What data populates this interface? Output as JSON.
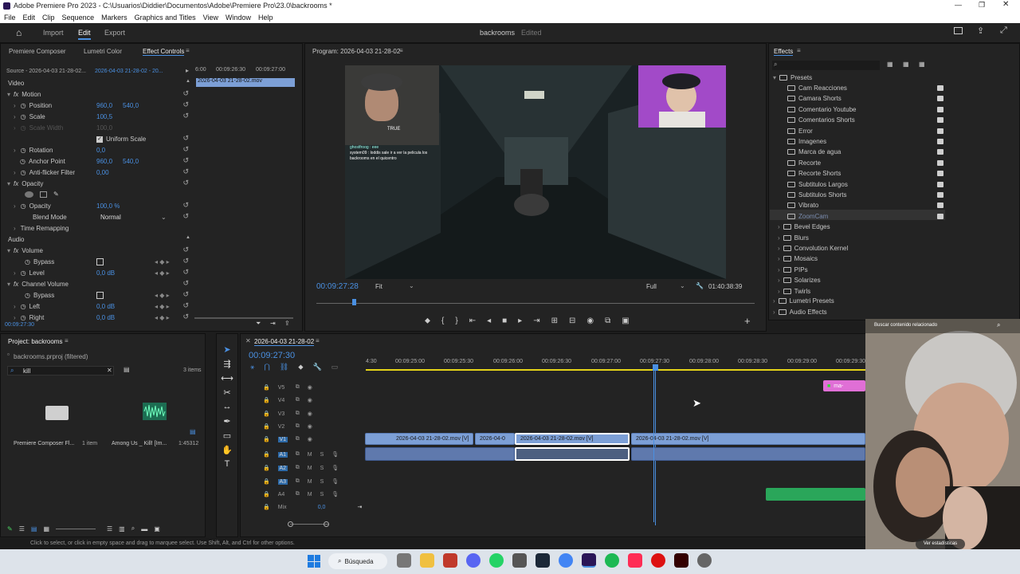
{
  "titlebar": {
    "title": "Adobe Premiere Pro 2023 - C:\\Usuarios\\Diddier\\Documentos\\Adobe\\Premiere Pro\\23.0\\backrooms *"
  },
  "menu": [
    "File",
    "Edit",
    "Clip",
    "Sequence",
    "Markers",
    "Graphics and Titles",
    "View",
    "Window",
    "Help"
  ],
  "workspace": {
    "tabs": [
      "Import",
      "Edit",
      "Export"
    ],
    "project_name": "backrooms",
    "status": "Edited"
  },
  "effect_controls": {
    "tabs": [
      "Premiere Composer",
      "Lumetri Color",
      "Effect Controls"
    ],
    "source": "Source - 2026-04-03 21-28-02...",
    "clip": "2026-04-03 21-28-02 - 20...",
    "ruler": [
      "6:00",
      "00:09:26:30",
      "00:09:27:00"
    ],
    "clip_bar": "2026-04-03 21-28-02.mov",
    "video_label": "Video",
    "audio_label": "Audio",
    "motion": "Motion",
    "position_label": "Position",
    "position_x": "960,0",
    "position_y": "540,0",
    "scale_label": "Scale",
    "scale_value": "100,5",
    "scale_width_label": "Scale Width",
    "scale_width_value": "100,0",
    "uniform_label": "Uniform Scale",
    "rotation_label": "Rotation",
    "rotation_value": "0,0",
    "anchor_label": "Anchor Point",
    "anchor_x": "960,0",
    "anchor_y": "540,0",
    "antiflicker_label": "Anti-flicker Filter",
    "antiflicker_value": "0,00",
    "opacity": "Opacity",
    "opacity_label": "Opacity",
    "opacity_value": "100,0 %",
    "blend_label": "Blend Mode",
    "blend_value": "Normal",
    "time_remap": "Time Remapping",
    "volume": "Volume",
    "bypass_label": "Bypass",
    "level_label": "Level",
    "level_value": "0,0 dB",
    "channel_volume": "Channel Volume",
    "left_label": "Left",
    "left_value": "0,0 dB",
    "right_label": "Right",
    "right_value": "0,0 dB",
    "timecode": "00:09:27:30"
  },
  "program": {
    "title": "Program: 2026-04-03 21-28-02",
    "timecode": "00:09:27:28",
    "fit": "Fit",
    "quality": "Full",
    "duration": "01:40:38:39",
    "chat_user1": "ghostfroog : eee",
    "chat_user2": "system09 : loddis sale ir a ver la pelicula los backrooms en el quicentro",
    "cam_caption": "TRUE"
  },
  "effects": {
    "title": "Effects",
    "presets_label": "Presets",
    "presets": [
      "Cam Reacciones",
      "Camara Shorts",
      "Comentario Youtube",
      "Comentarios Shorts",
      "Error",
      "Imagenes",
      "Marca de agua",
      "Recorte",
      "Recorte Shorts",
      "Subtitulos Largos",
      "Subtitulos Shorts",
      "Vibrato",
      "ZoomCam"
    ],
    "categories": [
      "Bevel Edges",
      "Blurs",
      "Convolution Kernel",
      "Mosaics",
      "PIPs",
      "Solarizes",
      "Twirls"
    ],
    "lumetri": "Lumetri Presets",
    "audio_effects": "Audio Effects"
  },
  "project": {
    "title": "Project: backrooms",
    "file": "backrooms.prproj (filtered)",
    "search": "kill",
    "items_count": "3 items",
    "item1_label": "Premiere Composer Fl...",
    "item1_meta": "1 item",
    "item2_label": "Among Us _ Kill! [Im...",
    "item2_meta": "1:45312"
  },
  "timeline": {
    "title": "2026-04-03 21-28-02",
    "timecode": "00:09:27:30",
    "ruler": [
      "4:30",
      "00:09:25:00",
      "00:09:25:30",
      "00:09:26:00",
      "00:09:26:30",
      "00:09:27:00",
      "00:09:27:30",
      "00:09:28:00",
      "00:09:28:30",
      "00:09:29:00",
      "00:09:29:30"
    ],
    "video_tracks": [
      "V5",
      "V4",
      "V3",
      "V2",
      "V1"
    ],
    "audio_tracks": [
      "A1",
      "A2",
      "A3",
      "A4"
    ],
    "mix_label": "Mix",
    "mix_value": "0,0",
    "clip_a": "2026-04-03 21-28-02.mov [V]",
    "clip_b": "2026-04-0",
    "clip_c": "2026-04-03 21-28-02.mov [V]",
    "clip_d": "2026-04-03 21-28-02.mov [V]",
    "clip_pink": "ma-"
  },
  "statusbar": "Click to select, or click in empty space and drag to marquee select. Use Shift, Alt, and Ctrl for other options.",
  "overlay": {
    "search": "Buscar contenido relacionado",
    "stats_button": "Ver estadísticas"
  },
  "taskbar": {
    "search": "Búsqueda"
  }
}
